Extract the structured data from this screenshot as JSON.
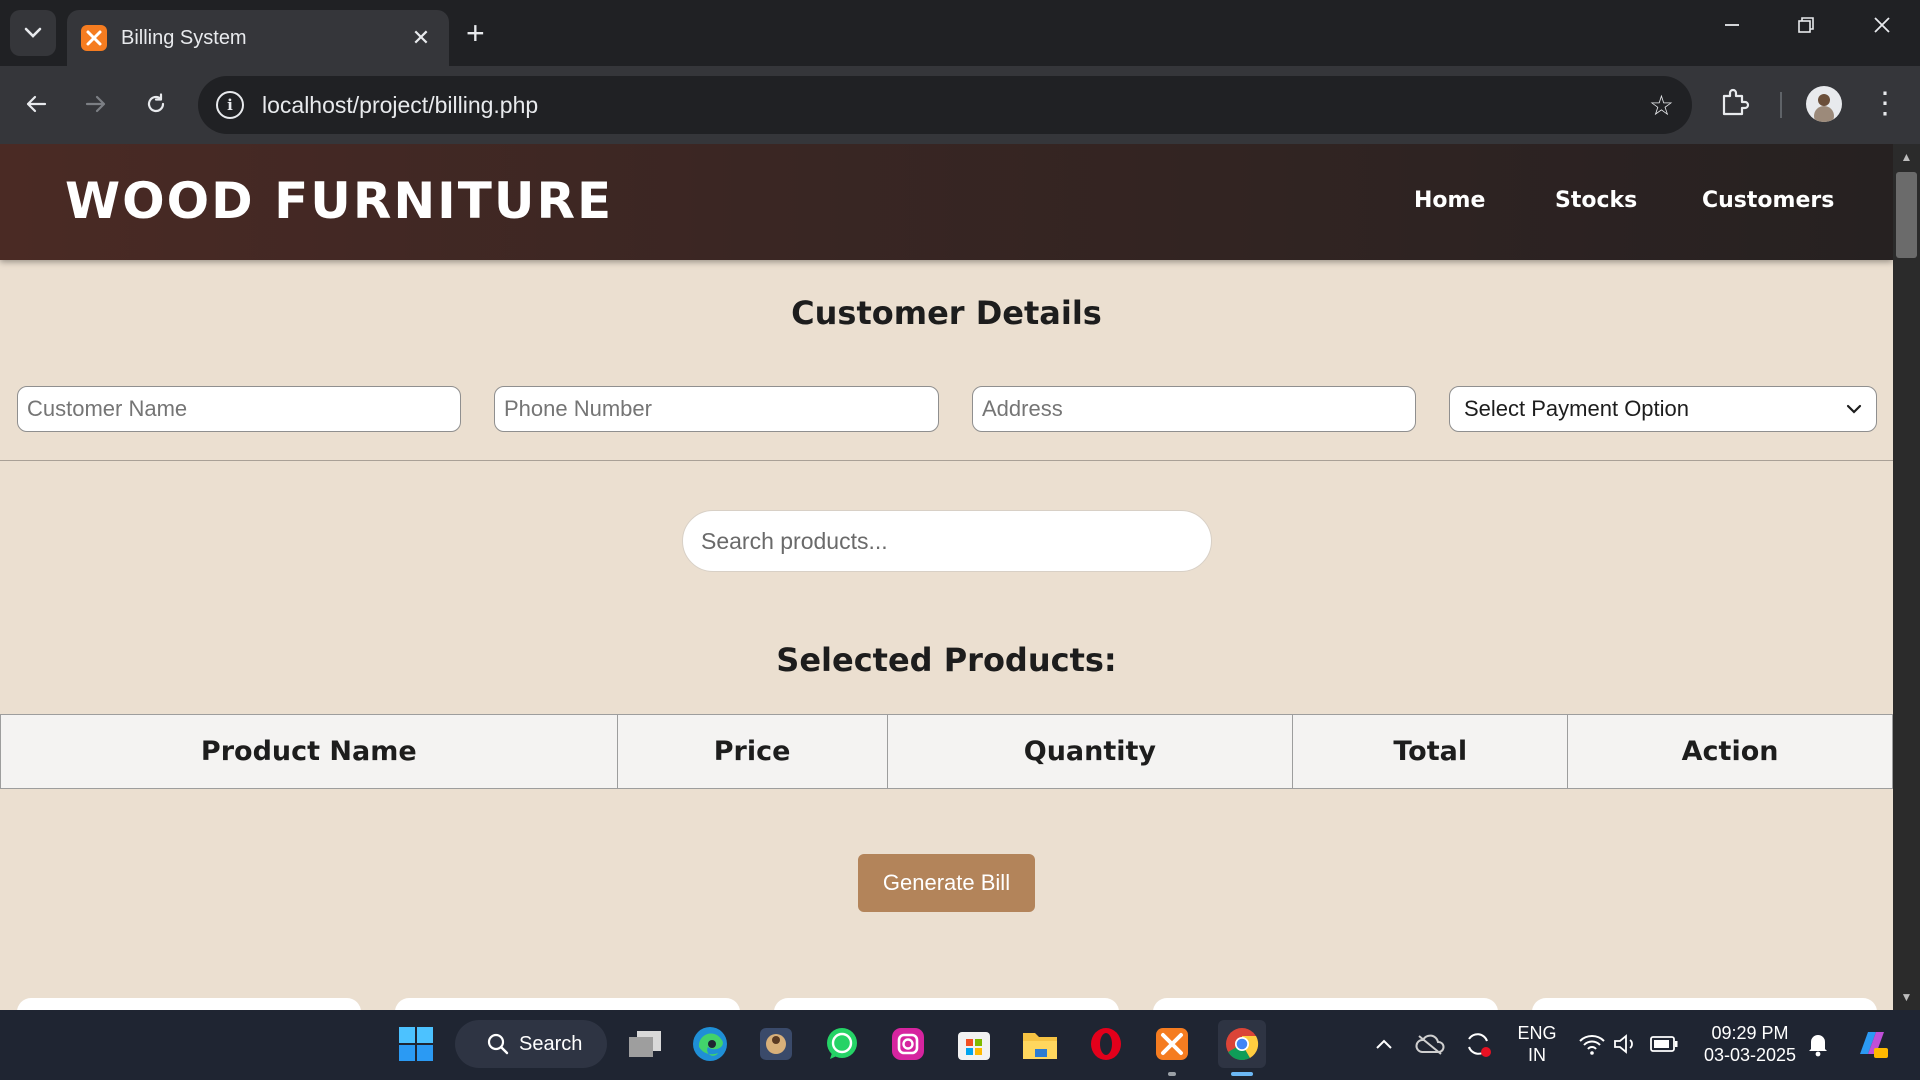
{
  "browser": {
    "tab_title": "Billing System",
    "tab_close": "✕",
    "new_tab": "+",
    "url": "localhost/project/billing.php",
    "star": "☆",
    "menu": "⋮"
  },
  "site": {
    "brand": "WOOD FURNITURE",
    "nav": [
      "Home",
      "Stocks",
      "Customers"
    ]
  },
  "customer_details": {
    "title": "Customer Details",
    "name_placeholder": "Customer Name",
    "phone_placeholder": "Phone Number",
    "address_placeholder": "Address",
    "payment_selected": "Select Payment Option"
  },
  "search": {
    "placeholder": "Search products..."
  },
  "selected_products": {
    "title": "Selected Products:",
    "columns": [
      "Product Name",
      "Price",
      "Quantity",
      "Total",
      "Action"
    ]
  },
  "generate_bill_label": "Generate Bill",
  "taskbar": {
    "search_label": "Search",
    "language": "ENG",
    "region": "IN",
    "time": "09:29 PM",
    "date": "03-03-2025"
  },
  "colors": {
    "page_bg": "#ebdfd0",
    "header_dark": "#262121",
    "header_brown": "#4a2a24",
    "accent_button": "#b3845a",
    "taskbar_bg": "#1f2532"
  }
}
